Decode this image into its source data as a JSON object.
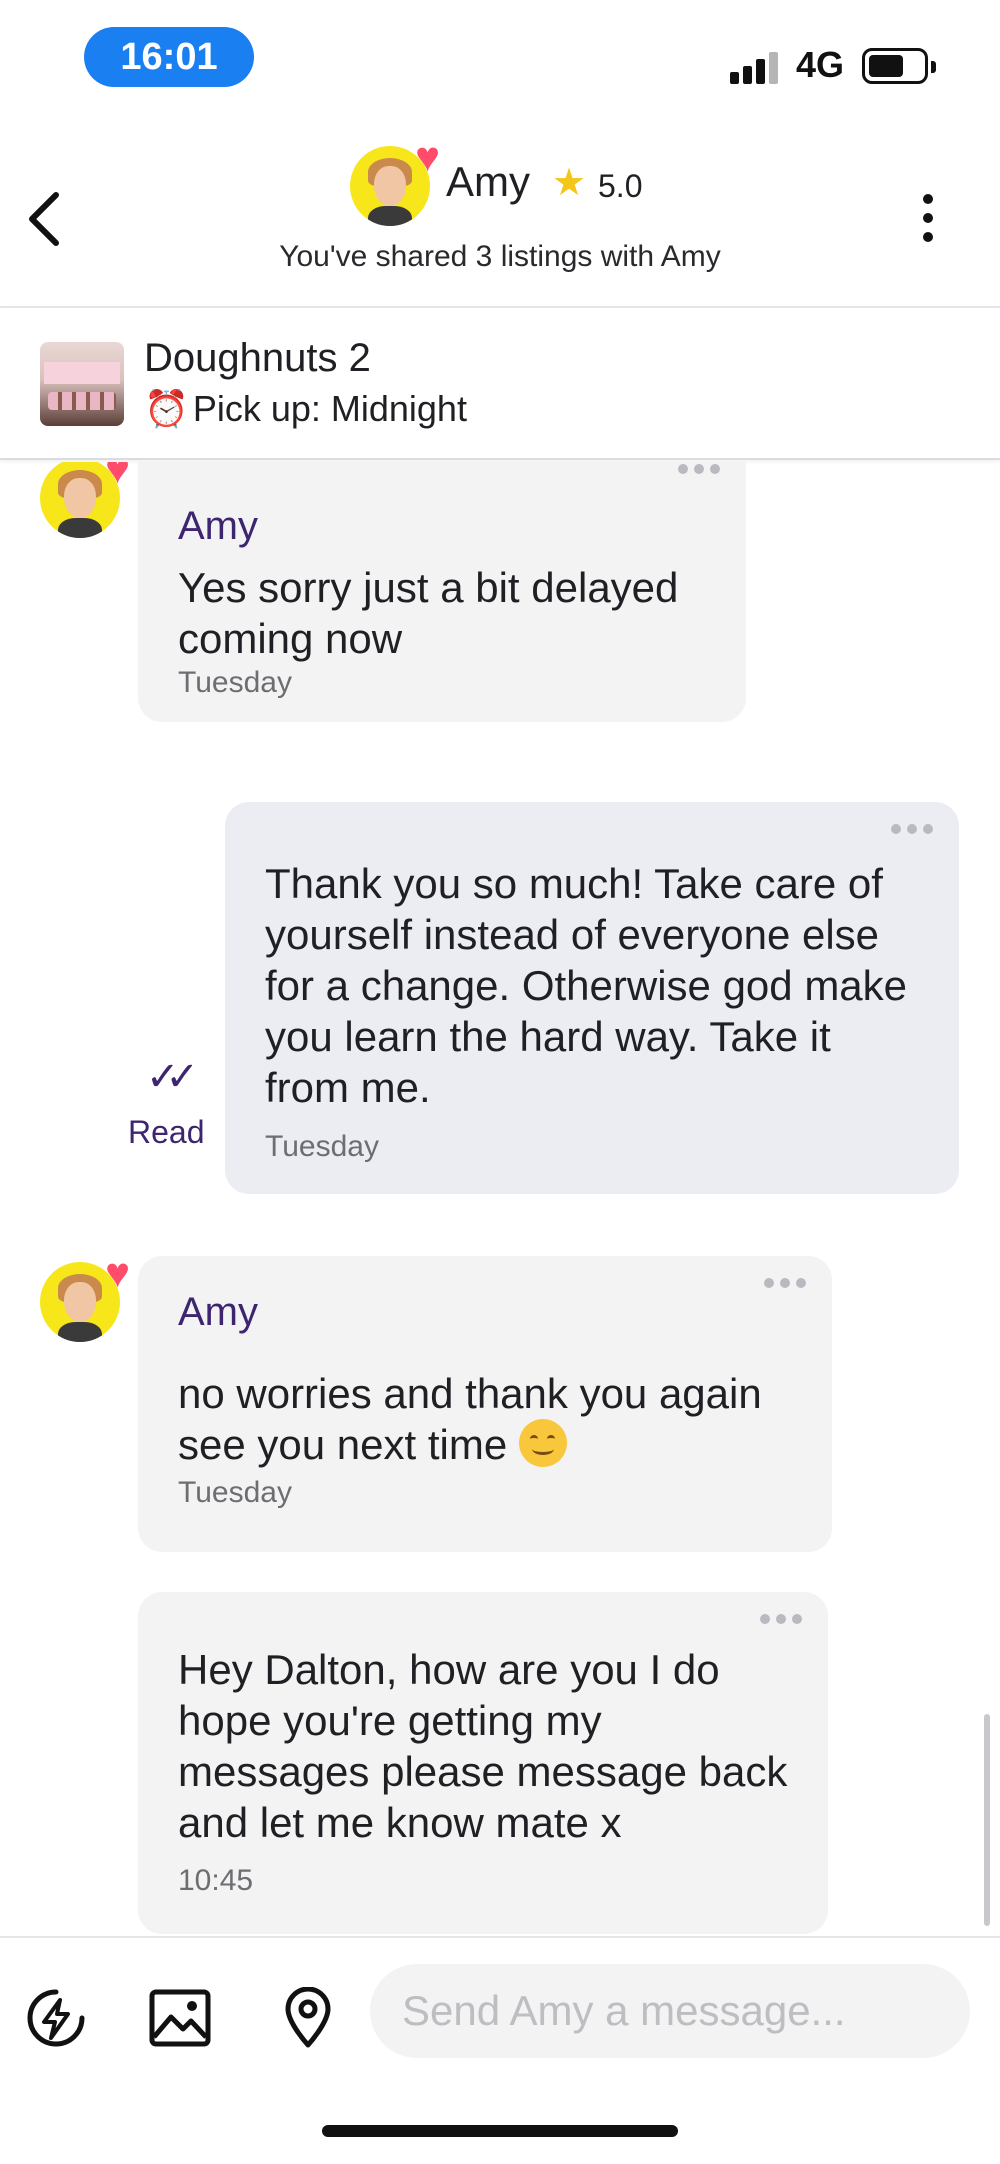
{
  "status_bar": {
    "time": "16:01",
    "network": "4G",
    "icons": [
      "signal-icon",
      "battery-icon"
    ]
  },
  "header": {
    "name": "Amy",
    "rating": "5.0",
    "shared_text": "You've shared 3 listings with Amy",
    "icons": [
      "back-chevron-icon",
      "star-icon",
      "more-vertical-icon"
    ]
  },
  "listing": {
    "title": "Doughnuts 2",
    "pickup": "Pick up: Midnight",
    "icons": [
      "alarm-clock-icon"
    ]
  },
  "messages": [
    {
      "direction": "received",
      "sender": "Amy",
      "text": "Yes sorry just a bit delayed coming now",
      "time": "Tuesday"
    },
    {
      "direction": "sent",
      "text": "Thank you so much! Take care of yourself instead of everyone else for a change. Otherwise god make you learn the hard way. Take it from me.",
      "time": "Tuesday",
      "status": "Read"
    },
    {
      "direction": "received",
      "sender": "Amy",
      "text": "no worries and thank you again see you next time",
      "time": "Tuesday"
    },
    {
      "direction": "received",
      "text": "Hey Dalton, how are you I do hope you're getting my messages please message back and let me know mate x",
      "time": "10:45"
    }
  ],
  "composer": {
    "placeholder": "Send Amy a message...",
    "icons": [
      "quick-reply-bolt-icon",
      "image-icon",
      "location-pin-icon"
    ]
  }
}
